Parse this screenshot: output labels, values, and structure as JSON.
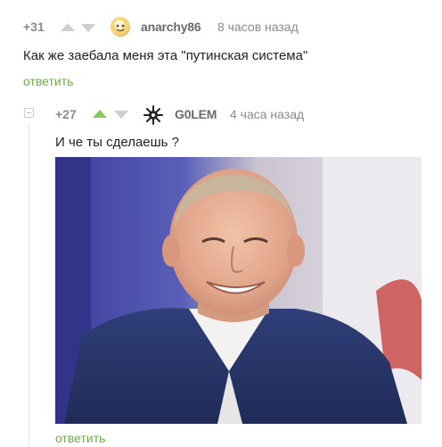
{
  "comment1": {
    "rating": "+31",
    "username": "anarchy86",
    "time": "8 часов назад",
    "text": "Как же заебала меня эта \"путинская система\"",
    "reply": "ответить",
    "avatar_icon": "cartoon-face-avatar"
  },
  "comment2": {
    "rating": "+27",
    "username": "G0LEM",
    "time": "4 часа назад",
    "text": "И че ты сделаешь ?",
    "reply": "ответить",
    "avatar_icon": "snowflake-emblem",
    "vote_state": "upvoted"
  },
  "colors": {
    "accent_green": "#6eae45",
    "upvote_active": "#8ac858",
    "muted_gray": "#8a8a8a"
  }
}
